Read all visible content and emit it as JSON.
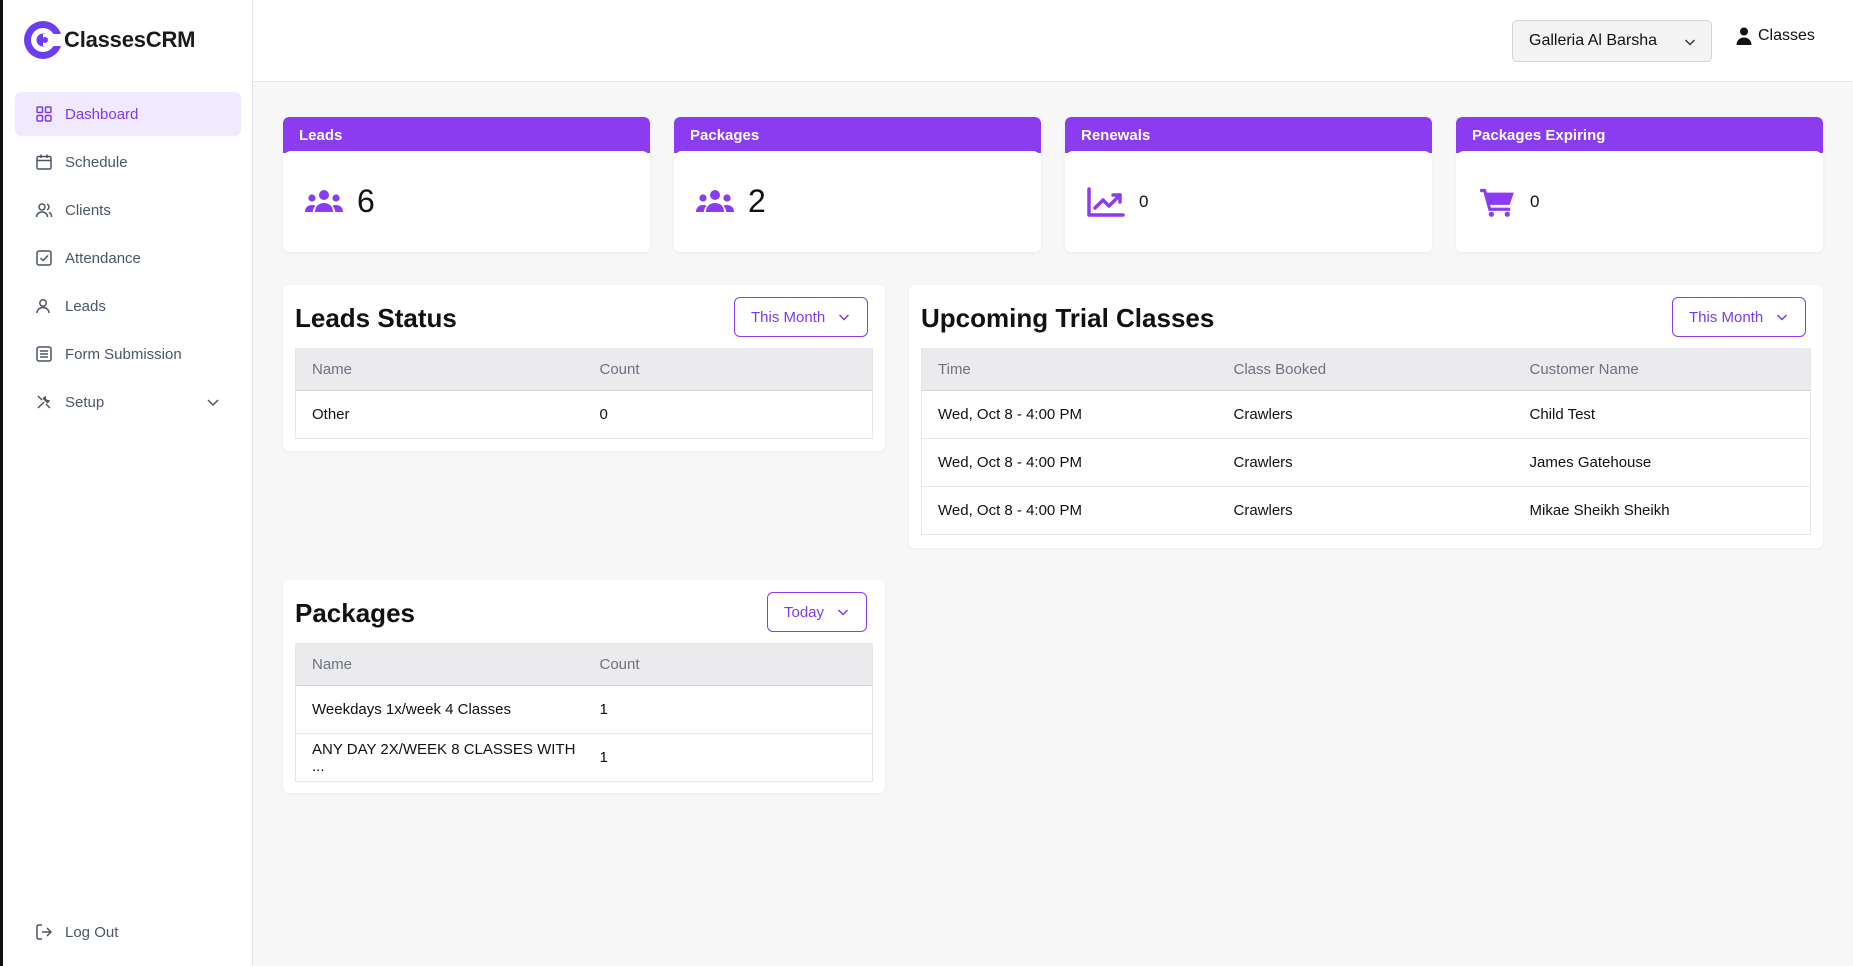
{
  "brand": {
    "name": "ClassesCRM"
  },
  "colors": {
    "accent": "#8b3cf0",
    "accent_text": "#7c3aed",
    "active_bg": "#f1e9ff"
  },
  "sidebar": {
    "items": [
      {
        "label": "Dashboard",
        "icon": "grid-icon",
        "active": true
      },
      {
        "label": "Schedule",
        "icon": "calendar-icon"
      },
      {
        "label": "Clients",
        "icon": "users-icon"
      },
      {
        "label": "Attendance",
        "icon": "checkbox-icon"
      },
      {
        "label": "Leads",
        "icon": "user-icon"
      },
      {
        "label": "Form Submission",
        "icon": "list-icon"
      },
      {
        "label": "Setup",
        "icon": "tools-icon"
      }
    ],
    "logout": "Log Out"
  },
  "header": {
    "location": "Galleria Al Barsha",
    "user_label": "Classes"
  },
  "stats": [
    {
      "title": "Leads",
      "value": "6",
      "icon": "users-group-icon"
    },
    {
      "title": "Packages",
      "value": "2",
      "icon": "users-group-icon"
    },
    {
      "title": "Renewals",
      "value": "0",
      "icon": "chart-line-icon"
    },
    {
      "title": "Packages Expiring",
      "value": "0",
      "icon": "cart-icon"
    }
  ],
  "leads_status": {
    "title": "Leads Status",
    "filter": "This Month",
    "columns": [
      "Name",
      "Count"
    ],
    "rows": [
      [
        "Other",
        "0"
      ]
    ]
  },
  "trials": {
    "title": "Upcoming Trial Classes",
    "filter": "This Month",
    "columns": [
      "Time",
      "Class Booked",
      "Customer Name"
    ],
    "rows": [
      [
        "Wed, Oct 8 - 4:00 PM",
        "Crawlers",
        "Child Test"
      ],
      [
        "Wed, Oct 8 - 4:00 PM",
        "Crawlers",
        "James Gatehouse"
      ],
      [
        "Wed, Oct 8 - 4:00 PM",
        "Crawlers",
        "Mikae Sheikh Sheikh"
      ]
    ]
  },
  "packages": {
    "title": "Packages",
    "filter": "Today",
    "columns": [
      "Name",
      "Count"
    ],
    "rows": [
      [
        "Weekdays 1x/week 4 Classes",
        "1"
      ],
      [
        "ANY DAY 2X/WEEK 8 CLASSES WITH ...",
        "1"
      ]
    ]
  }
}
